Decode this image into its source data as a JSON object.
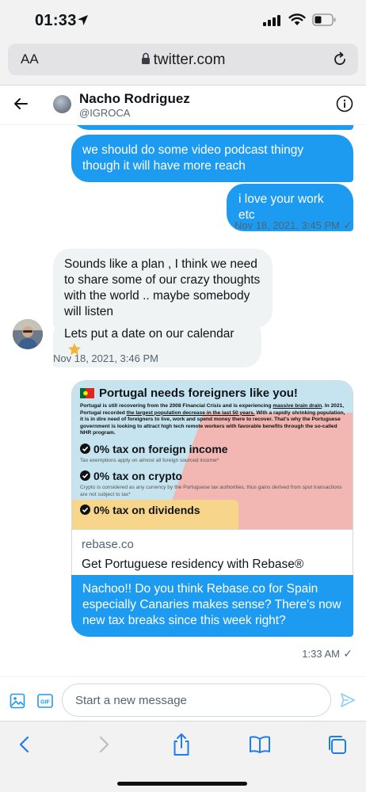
{
  "status_bar": {
    "time": "01:33"
  },
  "browser": {
    "aa_label": "AA",
    "url": "twitter.com",
    "accent_color": "#1c7cf6"
  },
  "header": {
    "name": "Nacho Rodriguez",
    "handle": "@IGROCA"
  },
  "messages": [
    {
      "direction": "out",
      "text": "we should do some video podcast thingy though it will have more reach"
    },
    {
      "direction": "out",
      "text": "i love your work etc",
      "timestamp": "Nov 18, 2021, 3:45 PM",
      "status": "✓"
    },
    {
      "direction": "in",
      "text": "Sounds like a plan , I think we need to share some of our crazy thoughts with the world .. maybe somebody will listen"
    },
    {
      "direction": "in",
      "text": "Lets put a date on our calendar",
      "timestamp": "Nov 18, 2021, 3:46 PM"
    }
  ],
  "link_card": {
    "image": {
      "title": "Portugal needs foreigners like you!",
      "desc_pre": "Portugal is still recovering from the 2008 Financial Crisis and is experiencing ",
      "desc_u1": "massive brain drain",
      "desc_mid": ". In 2021, Portugal recorded ",
      "desc_u2": "the largest population decrease in the last 50 years.",
      "desc_post": " With a rapidly shrinking population, it is in dire need of foreigners to live, work and spend money there to recover. That's why the Portuguese government is looking to attract high tech remote workers with favorable benefits through the so-called NHR program.",
      "points": [
        {
          "heading": "0% tax on foreign income",
          "note": "Tax exemptions apply on almost all foreign sourced income*"
        },
        {
          "heading": "0% tax on crypto",
          "note": "Crypto is considered as any currency by the Portuguese tax authorities, thus gains derived from spot transactions are not subject to tax*"
        },
        {
          "heading": "0% tax on dividends",
          "note": ""
        }
      ]
    },
    "domain": "rebase.co",
    "title": "Get Portuguese residency with Rebase®",
    "message": "Nachoo!! Do you think Rebase.co for Spain especially Canaries makes sense? There's now new tax breaks since this week right?",
    "timestamp": "1:33 AM",
    "status": "✓"
  },
  "compose": {
    "placeholder": "Start a new message"
  },
  "colors": {
    "twitter_blue": "#1d9bf0",
    "incoming_bg": "#eff3f4",
    "muted_text": "#536471",
    "browser_chrome": "#f2f2f2"
  },
  "icons": [
    "location-arrow-icon",
    "signal-icon",
    "wifi-icon",
    "battery-icon",
    "lock-icon",
    "reload-icon",
    "back-arrow-icon",
    "info-icon",
    "star-emoji-icon",
    "portugal-flag-icon",
    "checkmark-icon",
    "media-icon",
    "gif-icon",
    "send-icon",
    "safari-back-icon",
    "safari-forward-icon",
    "share-icon",
    "bookmarks-icon",
    "tabs-icon"
  ]
}
